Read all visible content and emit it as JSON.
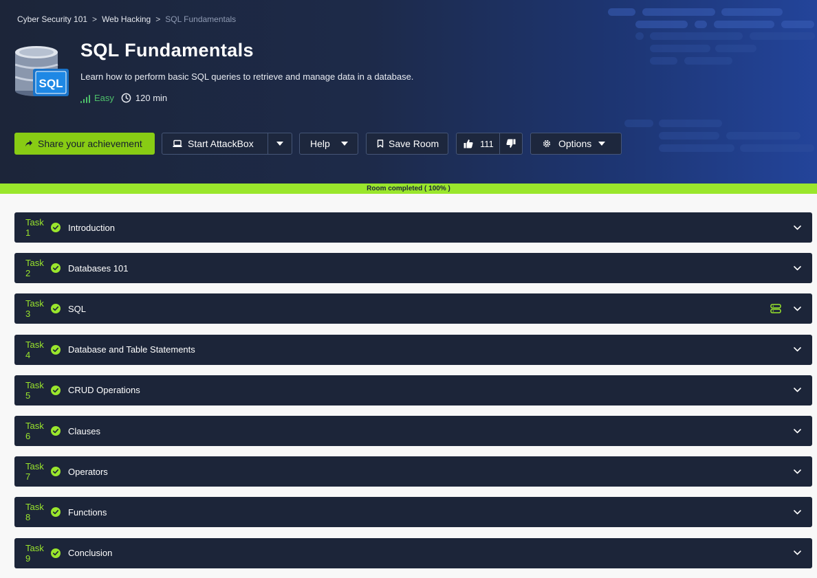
{
  "breadcrumb": {
    "items": [
      "Cyber Security 101",
      "Web Hacking"
    ],
    "separator": ">",
    "current": "SQL Fundamentals"
  },
  "room": {
    "title": "SQL Fundamentals",
    "description": "Learn how to perform basic SQL queries to retrieve and manage data in a database.",
    "logo_text": "SQL",
    "difficulty": "Easy",
    "duration": "120 min"
  },
  "toolbar": {
    "share_label": "Share your achievement",
    "attackbox_label": "Start AttackBox",
    "help_label": "Help",
    "save_label": "Save Room",
    "likes": "111",
    "options_label": "Options"
  },
  "progress": {
    "label": "Room completed ( 100% )",
    "percent": 100
  },
  "tasks": [
    {
      "number": "Task 1",
      "title": "Introduction",
      "completed": true,
      "has_machine": false
    },
    {
      "number": "Task 2",
      "title": "Databases 101",
      "completed": true,
      "has_machine": false
    },
    {
      "number": "Task 3",
      "title": "SQL",
      "completed": true,
      "has_machine": true
    },
    {
      "number": "Task 4",
      "title": "Database and Table Statements",
      "completed": true,
      "has_machine": false
    },
    {
      "number": "Task 5",
      "title": "CRUD Operations",
      "completed": true,
      "has_machine": false
    },
    {
      "number": "Task 6",
      "title": "Clauses",
      "completed": true,
      "has_machine": false
    },
    {
      "number": "Task 7",
      "title": "Operators",
      "completed": true,
      "has_machine": false
    },
    {
      "number": "Task 8",
      "title": "Functions",
      "completed": true,
      "has_machine": false
    },
    {
      "number": "Task 9",
      "title": "Conclusion",
      "completed": true,
      "has_machine": false
    }
  ],
  "colors": {
    "accent": "#9ae62c",
    "share_button": "#88cc14",
    "header_bg": "#1c2539",
    "difficulty_easy": "#4ec16b",
    "task_bg": "#1c2539"
  },
  "icons": {
    "share": "share-icon",
    "attackbox": "laptop-icon",
    "dropdown": "caret-down-icon",
    "save": "bookmark-icon",
    "like": "thumbs-up-icon",
    "dislike": "thumbs-down-icon",
    "options": "gear-icon",
    "difficulty": "signal-bars-icon",
    "duration": "clock-icon",
    "task_complete": "check-circle-icon",
    "machine": "server-icon",
    "expand": "chevron-down-icon"
  }
}
